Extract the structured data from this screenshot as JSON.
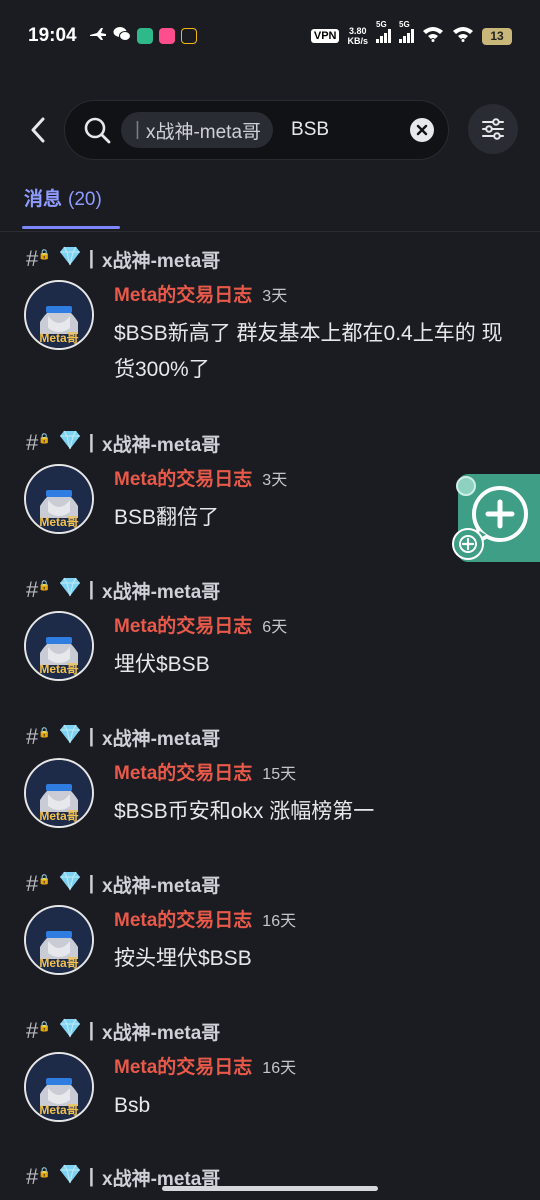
{
  "status_bar": {
    "time": "19:04",
    "vpn": "VPN",
    "net_speed_value": "3.80",
    "net_speed_unit": "KB/s",
    "signal1_gen": "5G",
    "signal2_gen": "5G",
    "battery": "13"
  },
  "search": {
    "channel_chip": "x战神-meta哥",
    "query": "BSB"
  },
  "tab": {
    "label": "消息",
    "count": "(20)"
  },
  "results": [
    {
      "channel": "x战神-meta哥",
      "author": "Meta的交易日志",
      "time": "3天",
      "avatar_text": "Meta哥",
      "message": "$BSB新高了 群友基本上都在0.4上车的 现货300%了"
    },
    {
      "channel": "x战神-meta哥",
      "author": "Meta的交易日志",
      "time": "3天",
      "avatar_text": "Meta哥",
      "message": "BSB翻倍了"
    },
    {
      "channel": "x战神-meta哥",
      "author": "Meta的交易日志",
      "time": "6天",
      "avatar_text": "Meta哥",
      "message": "埋伏$BSB"
    },
    {
      "channel": "x战神-meta哥",
      "author": "Meta的交易日志",
      "time": "15天",
      "avatar_text": "Meta哥",
      "message": "$BSB币安和okx 涨幅榜第一"
    },
    {
      "channel": "x战神-meta哥",
      "author": "Meta的交易日志",
      "time": "16天",
      "avatar_text": "Meta哥",
      "message": "按头埋伏$BSB"
    },
    {
      "channel": "x战神-meta哥",
      "author": "Meta的交易日志",
      "time": "16天",
      "avatar_text": "Meta哥",
      "message": "Bsb"
    },
    {
      "channel": "x战神-meta哥"
    }
  ],
  "icons": {
    "back": "chevron-left-icon",
    "search": "search-icon",
    "clear": "clear-icon",
    "filter": "filter-sliders-icon",
    "channel": "hash-lock-icon",
    "gem": "diamond-icon"
  },
  "colors": {
    "background": "#1b1c21",
    "accent": "#8f9cff",
    "author": "#e8594a",
    "widget": "#3e9e86"
  }
}
